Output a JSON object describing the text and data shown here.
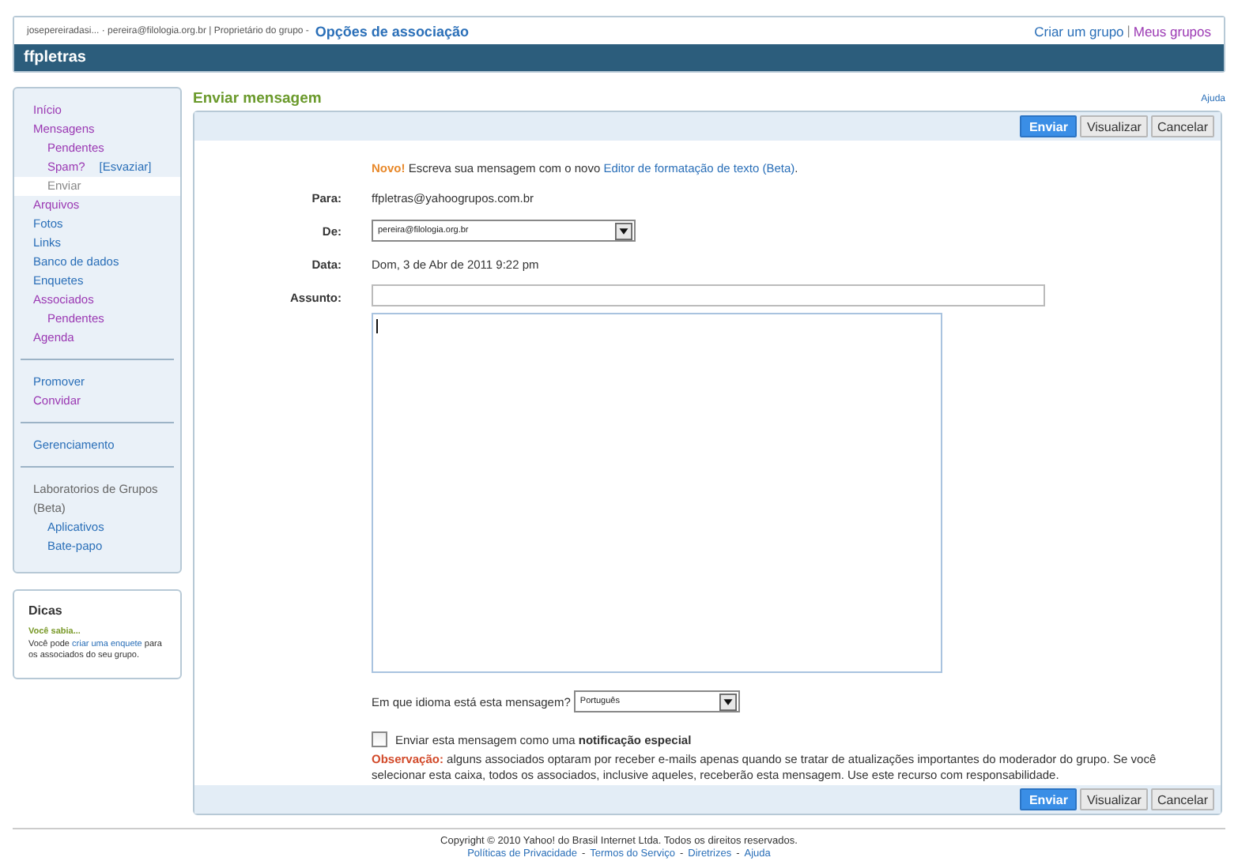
{
  "header": {
    "breadcrumb": "josepereiradasi... · pereira@filologia.org.br | Proprietário do grupo -",
    "section_title": "Opções de associação",
    "links": [
      {
        "label": "Criar um grupo",
        "visited": false
      },
      {
        "label": "Meus grupos",
        "visited": true
      }
    ],
    "link_separator": "|",
    "group_name": "ffpletras"
  },
  "sidebar": {
    "sections": [
      {
        "items": [
          {
            "label": "Início",
            "visited": true,
            "selected": false
          },
          {
            "label": "Mensagens",
            "visited": true,
            "selected": false,
            "children": [
              {
                "label": "Pendentes",
                "visited": true,
                "selected": false
              },
              {
                "label": "Spam?",
                "visited": true,
                "selected": false,
                "action": "[Esvaziar]"
              },
              {
                "label": "Enviar",
                "visited": false,
                "selected": true
              }
            ]
          },
          {
            "label": "Arquivos",
            "visited": true,
            "selected": false
          },
          {
            "label": "Fotos",
            "visited": false,
            "selected": false
          },
          {
            "label": "Links",
            "visited": false,
            "selected": false
          },
          {
            "label": "Banco de dados",
            "visited": false,
            "selected": false
          },
          {
            "label": "Enquetes",
            "visited": false,
            "selected": false
          },
          {
            "label": "Associados",
            "visited": true,
            "selected": false,
            "children": [
              {
                "label": "Pendentes",
                "visited": true,
                "selected": false
              }
            ]
          },
          {
            "label": "Agenda",
            "visited": true,
            "selected": false
          }
        ]
      },
      {
        "items": [
          {
            "label": "Promover",
            "visited": false,
            "selected": false
          },
          {
            "label": "Convidar",
            "visited": true,
            "selected": false
          }
        ]
      },
      {
        "items": [
          {
            "label": "Gerenciamento",
            "visited": false,
            "selected": false
          }
        ]
      },
      {
        "heading": "Laboratorios de Grupos (Beta)",
        "items": [
          {
            "label": "Aplicativos",
            "visited": false,
            "selected": false
          },
          {
            "label": "Bate-papo",
            "visited": false,
            "selected": false
          }
        ]
      }
    ],
    "tips": {
      "title": "Dicas",
      "subtitle": "Você sabia...",
      "text_before": "Você pode",
      "link": "criar uma enquete",
      "text_after": "para os associados do seu grupo."
    }
  },
  "main": {
    "title": "Enviar mensagem",
    "help_link": "Ajuda",
    "top_buttons": [
      {
        "label": "Enviar",
        "kind": "primary"
      },
      {
        "label": "Visualizar",
        "kind": "secondary"
      },
      {
        "label": "Cancelar",
        "kind": "secondary"
      }
    ],
    "bottom_buttons": [
      {
        "label": "Enviar",
        "kind": "primary"
      },
      {
        "label": "Visualizar",
        "kind": "secondary"
      },
      {
        "label": "Cancelar",
        "kind": "secondary"
      }
    ],
    "notice": {
      "badge": "Novo!",
      "text": "Escreva sua mensagem com o novo",
      "link": "Editor de formatação de texto (Beta)",
      "end": "."
    },
    "fields": [
      {
        "label": "Para:",
        "kind": "text",
        "value": "ffpletras@yahoogrupos.com.br"
      },
      {
        "label": "De:",
        "kind": "select",
        "value": "pereira@filologia.org.br"
      },
      {
        "label": "Data:",
        "kind": "text",
        "value": "Dom, 3 de Abr de 2011 9:22 pm"
      },
      {
        "label": "Assunto:",
        "kind": "input"
      },
      {
        "kind": "textarea"
      }
    ],
    "language": {
      "label": "Em que idioma está esta mensagem?",
      "value": "Português"
    },
    "special": {
      "label": "Enviar esta mensagem como uma **notificação especial**",
      "checked": false
    },
    "note": {
      "label": "Observação:",
      "text": "alguns associados optaram por receber e-mails apenas quando se tratar de atualizações importantes do moderador do grupo. Se você selecionar esta caixa, todos os associados, inclusive aqueles, receberão esta mensagem. Use este recurso com responsabilidade."
    }
  },
  "footer": {
    "copyright": "Copyright © 2010 Yahoo! do Brasil Internet Ltda. Todos os direitos reservados.",
    "links": [
      "Políticas de Privacidade",
      "Termos do Serviço",
      "Diretrizes",
      "Ajuda"
    ],
    "link_separator": "-"
  }
}
